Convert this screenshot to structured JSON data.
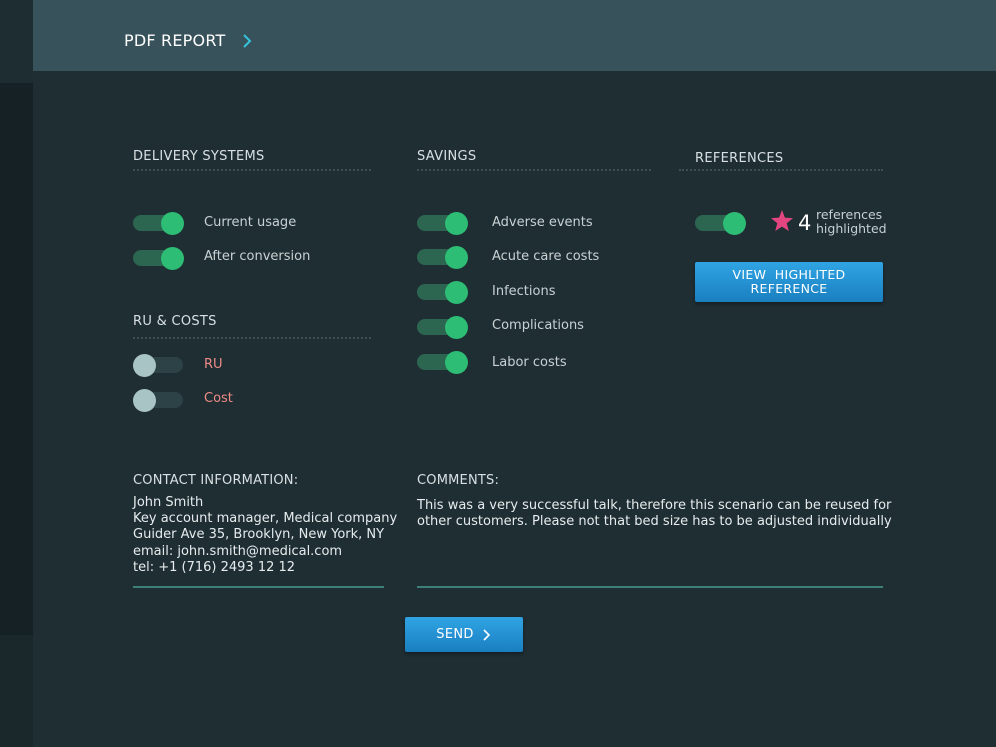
{
  "header": {
    "title": "PDF REPORT"
  },
  "delivery": {
    "title": "DELIVERY SYSTEMS",
    "items": [
      {
        "label": "Current usage",
        "on": true
      },
      {
        "label": "After conversion",
        "on": true
      }
    ]
  },
  "ru_costs": {
    "title": "RU & COSTS",
    "items": [
      {
        "label": "RU",
        "on": false
      },
      {
        "label": "Cost",
        "on": false
      }
    ]
  },
  "savings": {
    "title": "SAVINGS",
    "items": [
      {
        "label": "Adverse events",
        "on": true
      },
      {
        "label": "Acute care costs",
        "on": true
      },
      {
        "label": "Infections",
        "on": true
      },
      {
        "label": "Complications",
        "on": true
      },
      {
        "label": "Labor costs",
        "on": true
      }
    ]
  },
  "references": {
    "title": "REFERENCES",
    "toggle_on": true,
    "count": "4",
    "text_line1": "references",
    "text_line2": "highlighted",
    "button_line1": "VIEW  HIGHLITED",
    "button_line2": "REFERENCE"
  },
  "contact": {
    "title": "CONTACT INFORMATION:",
    "lines": [
      "John Smith",
      "Key account manager, Medical company",
      "Guider Ave 35, Brooklyn, New York, NY",
      "email: john.smith@medical.com",
      "tel: +1 (716) 2493 12 12"
    ]
  },
  "comments": {
    "title": "COMMENTS:",
    "lines": [
      "This was a very successful talk, therefore this scenario can be reused for",
      "other customers.  Please not that bed size has to be adjusted individually"
    ]
  },
  "send": {
    "label": "SEND"
  },
  "colors": {
    "toggle_on": "#2dbd75",
    "toggle_off_knob": "#a8c4c5",
    "accent_blue": "#1f8fd3",
    "star": "#e2457f",
    "warn_text": "#ee8b86"
  },
  "icons": {
    "header_chevron": "chevron-right-icon",
    "send_chevron": "chevron-right-icon",
    "reference_star": "star-icon"
  }
}
